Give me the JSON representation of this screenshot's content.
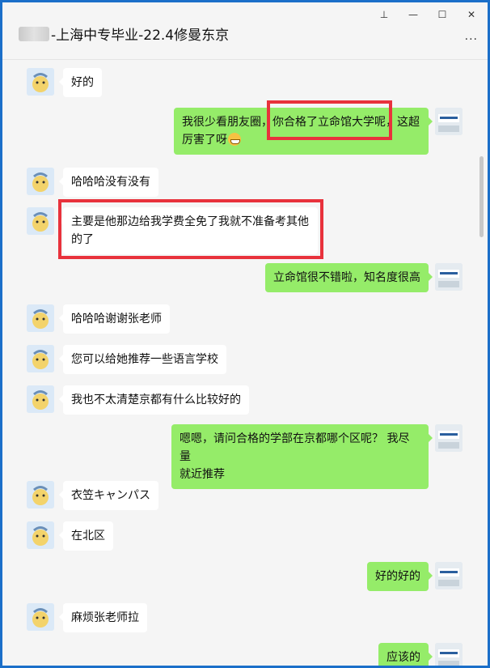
{
  "window": {
    "title_name_redacted": "",
    "title_text": "-上海中专毕业-22.4修曼东京",
    "controls": {
      "pin": "⊥",
      "minimize": "—",
      "maximize": "☐",
      "close": "✕"
    },
    "more": "···"
  },
  "messages": [
    {
      "side": "in",
      "text": "好的"
    },
    {
      "side": "out",
      "text_line1": "我很少看朋友圈，你合格了立命馆大学呢，这超",
      "text_line2": "厉害了呀",
      "emoji": "grin-emoji"
    },
    {
      "side": "in",
      "text": "哈哈哈没有没有"
    },
    {
      "side": "in",
      "text_line1": "主要是他那边给我学费全免了我就不准备考其他",
      "text_line2": "的了"
    },
    {
      "side": "out",
      "text": "立命馆很不错啦，知名度很高"
    },
    {
      "side": "in",
      "text": "哈哈哈谢谢张老师"
    },
    {
      "side": "in",
      "text": "您可以给她推荐一些语言学校"
    },
    {
      "side": "in",
      "text": "我也不太清楚京都有什么比较好的"
    },
    {
      "side": "out",
      "text_line1": "嗯嗯，请问合格的学部在京都哪个区呢？ 我尽量",
      "text_line2": "就近推荐"
    },
    {
      "side": "in",
      "text": "衣笠キャンパス"
    },
    {
      "side": "in",
      "text": "在北区"
    },
    {
      "side": "out",
      "text": "好的好的"
    },
    {
      "side": "in",
      "text": "麻烦张老师拉"
    },
    {
      "side": "out",
      "text": "应该的"
    }
  ],
  "colors": {
    "out_bubble": "#95ec69",
    "in_bubble": "#ffffff",
    "highlight": "#e8323c"
  }
}
